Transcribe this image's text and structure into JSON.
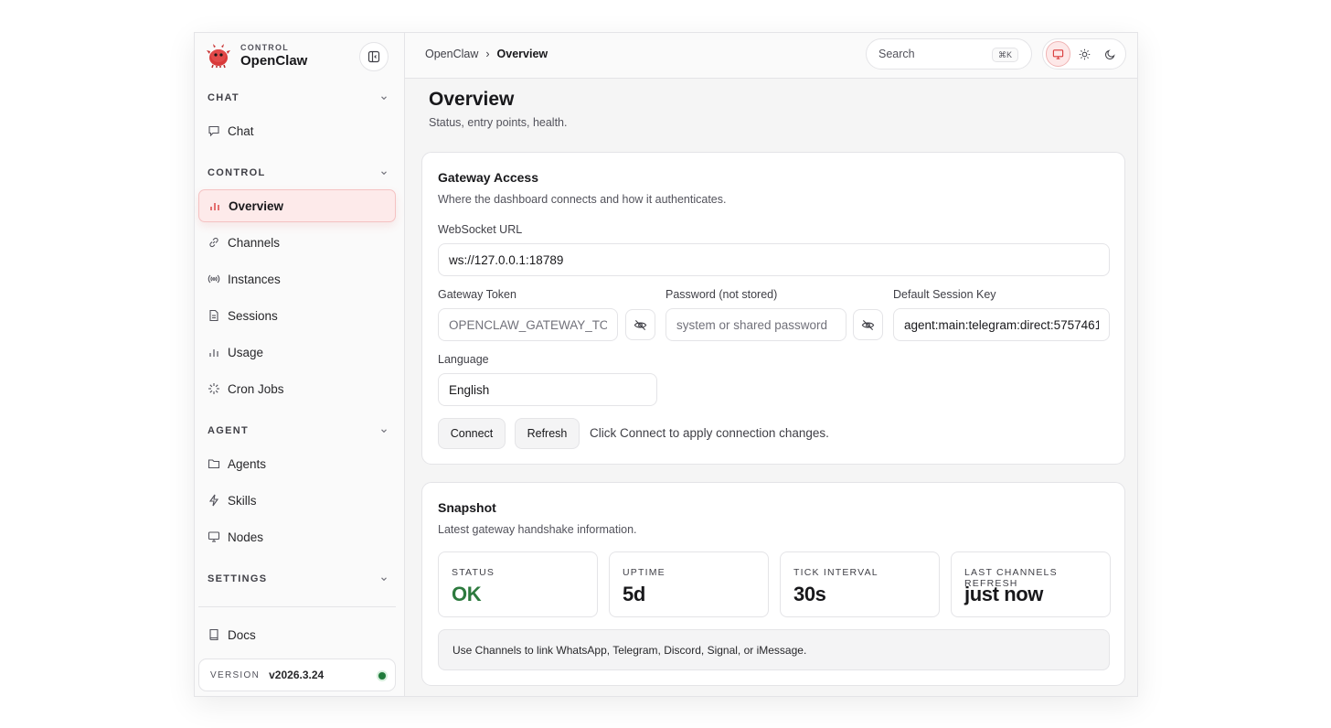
{
  "brand": {
    "eyebrow": "CONTROL",
    "name": "OpenClaw",
    "accent": "#d93a3a"
  },
  "sidebar": {
    "sections": [
      {
        "title": "CHAT",
        "items": [
          {
            "label": "Chat",
            "icon": "chat-bubble-icon"
          }
        ]
      },
      {
        "title": "CONTROL",
        "items": [
          {
            "label": "Overview",
            "icon": "bar-chart-icon",
            "active": true
          },
          {
            "label": "Channels",
            "icon": "link-icon"
          },
          {
            "label": "Instances",
            "icon": "broadcast-icon"
          },
          {
            "label": "Sessions",
            "icon": "document-icon"
          },
          {
            "label": "Usage",
            "icon": "bar-chart-icon"
          },
          {
            "label": "Cron Jobs",
            "icon": "loader-icon"
          }
        ]
      },
      {
        "title": "AGENT",
        "items": [
          {
            "label": "Agents",
            "icon": "folder-icon"
          },
          {
            "label": "Skills",
            "icon": "lightning-icon"
          },
          {
            "label": "Nodes",
            "icon": "monitor-icon"
          }
        ]
      },
      {
        "title": "SETTINGS",
        "items": []
      }
    ],
    "docs_label": "Docs",
    "version": {
      "label": "VERSION",
      "value": "v2026.3.24",
      "status_color": "#1f7a3a"
    }
  },
  "topbar": {
    "breadcrumb_root": "OpenClaw",
    "breadcrumb_sep": "›",
    "breadcrumb_current": "Overview",
    "search_placeholder": "Search",
    "search_shortcut": "⌘K",
    "theme_modes": [
      "system",
      "light",
      "dark"
    ],
    "theme_selected": "system"
  },
  "page": {
    "title": "Overview",
    "subtitle": "Status, entry points, health."
  },
  "gateway": {
    "title": "Gateway Access",
    "subtitle": "Where the dashboard connects and how it authenticates.",
    "ws_label": "WebSocket URL",
    "ws_value": "ws://127.0.0.1:18789",
    "token_label": "Gateway Token",
    "token_placeholder": "OPENCLAW_GATEWAY_TOKEN",
    "password_label": "Password (not stored)",
    "password_placeholder": "system or shared password",
    "session_label": "Default Session Key",
    "session_value": "agent:main:telegram:direct:5757461",
    "language_label": "Language",
    "language_value": "English",
    "connect_label": "Connect",
    "refresh_label": "Refresh",
    "hint": "Click Connect to apply connection changes."
  },
  "snapshot": {
    "title": "Snapshot",
    "subtitle": "Latest gateway handshake information.",
    "stats": [
      {
        "label": "STATUS",
        "value": "OK",
        "color": "#2d7a3e"
      },
      {
        "label": "UPTIME",
        "value": "5d"
      },
      {
        "label": "TICK INTERVAL",
        "value": "30s"
      },
      {
        "label": "LAST CHANNELS REFRESH",
        "value": "just now"
      }
    ],
    "callout": "Use Channels to link WhatsApp, Telegram, Discord, Signal, or iMessage."
  }
}
